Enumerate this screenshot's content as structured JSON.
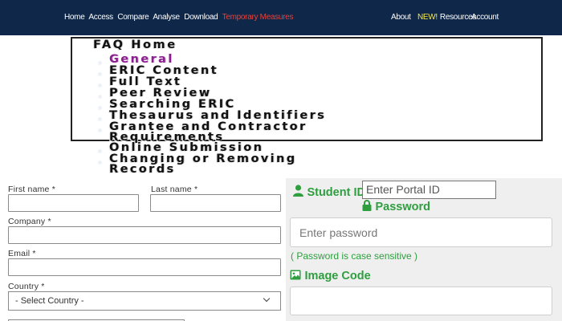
{
  "nav": {
    "left_items": [
      "Home",
      "Access",
      "Compare",
      "Analyse",
      "Download"
    ],
    "temporary_measures": "Temporary Measures",
    "about": "About",
    "new_badge": "NEW!",
    "resources": "Resources",
    "account": "Account",
    "accent_color": "#e8413a",
    "badge_color": "#f6e84a",
    "bar_color": "#0f2748"
  },
  "faq": {
    "title": "FAQ Home",
    "items": [
      "General",
      "ERIC Content",
      "Full Text",
      "Peer Review",
      "Searching ERIC",
      "Thesaurus and Identifiers",
      "Grantee and Contractor",
      "Requirements",
      "Online Submission",
      "Changing or Removing",
      "Records"
    ],
    "active_color": "#8b1f8f"
  },
  "form": {
    "first_name_label": "First name *",
    "last_name_label": "Last name *",
    "company_label": "Company *",
    "email_label": "Email *",
    "country_label": "Country *",
    "country_selected": "- Select Country -"
  },
  "login": {
    "student_id_label": "Student ID",
    "portal_id_placeholder": "Enter Portal ID",
    "password_label": "Password",
    "password_placeholder": "Enter password",
    "password_hint": "( Password is case sensitive )",
    "image_code_label": "Image Code",
    "label_color": "#2e9e3f",
    "user_icon": "user-icon",
    "lock_icon": "lock-icon",
    "image_icon": "image-icon"
  }
}
